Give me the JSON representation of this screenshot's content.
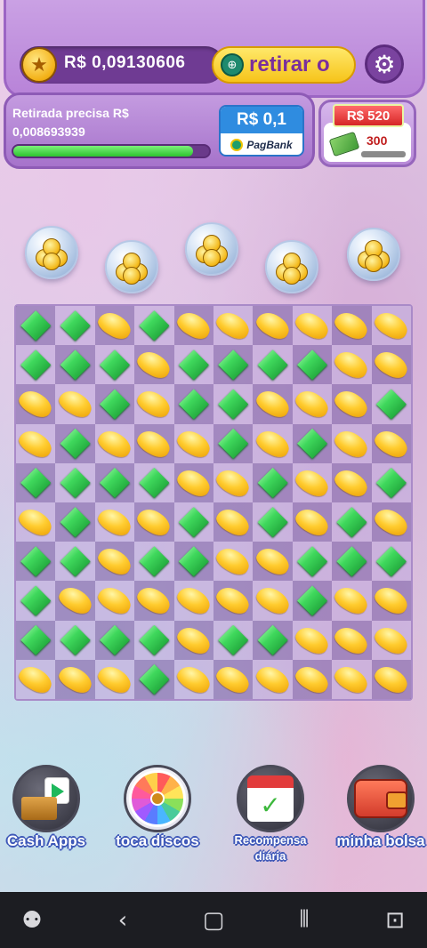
{
  "header": {
    "balance": "R$ 0,09130606",
    "withdraw_label": "retirar o",
    "withdraw_need_line1": "Retirada precisa R$",
    "withdraw_need_line2": "0,008693939",
    "withdraw_progress_percent": 92,
    "pagbank_amount": "R$ 0,1",
    "pagbank_brand": "PagBank",
    "reward_price": "R$ 520",
    "reward_count": "300"
  },
  "bubbles": [
    "coin-bubble",
    "coin-bubble",
    "coin-bubble",
    "coin-bubble",
    "coin-bubble"
  ],
  "board": {
    "legend": {
      "G": "green-gem",
      "Y": "yellow-jellybean"
    },
    "rows": [
      "GGYGYYYYYY",
      "GGGYGGGGYY",
      "YYGYGGYYYG",
      "YGYYYGYGYY",
      "GGGGYYGYYG",
      "YGYYGYGYGY",
      "GGYGGYYGGG",
      "GYYYYYYGYY",
      "GGGGYGGYYY",
      "YYYGYYYYYY"
    ]
  },
  "menu": {
    "cash_apps": "Cash Apps",
    "spinner": "toca discos",
    "daily_line1": "Recompensa",
    "daily_line2": "diária",
    "wallet": "minha bolsa"
  },
  "icons": {
    "settings": "gear-icon",
    "coin": "star-coin-icon",
    "nav": [
      "game-launcher-icon",
      "back-icon",
      "home-icon",
      "recents-icon",
      "accessibility-icon"
    ]
  },
  "colors": {
    "accent": "#b883d8",
    "progress": "#2dc42f",
    "withdraw_button": "#f6c41a"
  }
}
